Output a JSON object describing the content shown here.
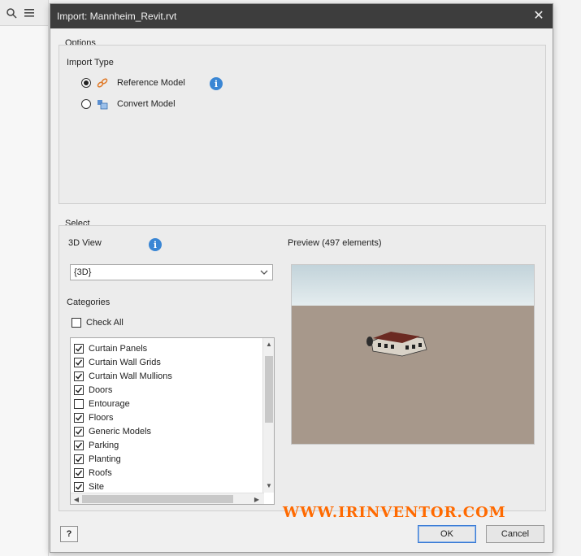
{
  "dialog": {
    "title": "Import:  Mannheim_Revit.rvt",
    "close_label": "✕"
  },
  "options": {
    "label": "Options",
    "import_type_label": "Import Type",
    "reference_model_label": "Reference Model",
    "convert_model_label": "Convert Model",
    "selected": "Reference Model"
  },
  "select": {
    "label": "Select",
    "view_label": "3D View",
    "view_value": "{3D}",
    "preview_label": "Preview (497 elements)",
    "categories_label": "Categories",
    "check_all_label": "Check All",
    "check_all_checked": false,
    "categories": [
      {
        "label": "Curtain Panels",
        "checked": true
      },
      {
        "label": "Curtain Wall Grids",
        "checked": true
      },
      {
        "label": "Curtain Wall Mullions",
        "checked": true
      },
      {
        "label": "Doors",
        "checked": true
      },
      {
        "label": "Entourage",
        "checked": false
      },
      {
        "label": "Floors",
        "checked": true
      },
      {
        "label": "Generic Models",
        "checked": true
      },
      {
        "label": "Parking",
        "checked": true
      },
      {
        "label": "Planting",
        "checked": true
      },
      {
        "label": "Roofs",
        "checked": true
      },
      {
        "label": "Site",
        "checked": true
      }
    ]
  },
  "footer": {
    "help_label": "?",
    "ok_label": "OK",
    "cancel_label": "Cancel"
  },
  "watermark": "WWW.IRINVENTOR.COM",
  "colors": {
    "titlebar": "#3d3d3d",
    "info_blue": "#3a86d4",
    "watermark": "#ff6a00"
  }
}
